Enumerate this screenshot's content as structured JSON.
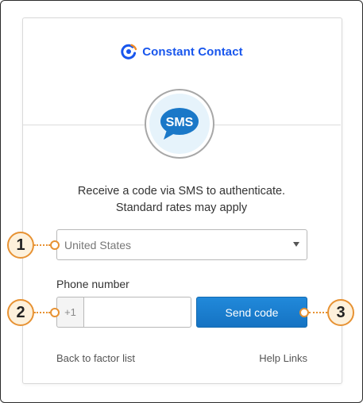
{
  "brand": {
    "name": "Constant Contact",
    "color": "#1856ed",
    "accent": "#f08a24",
    "icon": "constant-contact-logo-icon"
  },
  "sms_badge": {
    "text": "SMS",
    "icon": "sms-speech-bubble-icon",
    "color": "#1a78c8"
  },
  "message": {
    "line1": "Receive a code via SMS to authenticate.",
    "line2": "Standard rates may apply"
  },
  "country_select": {
    "selected": "United States",
    "icon": "chevron-down-icon"
  },
  "phone": {
    "label": "Phone number",
    "prefix": "+1",
    "value": "",
    "placeholder": ""
  },
  "send_button": {
    "label": "Send code",
    "color": "#1a7fd0"
  },
  "footer": {
    "back_label": "Back to factor list",
    "help_label": "Help Links"
  },
  "callouts": {
    "one": "1",
    "two": "2",
    "three": "3",
    "color": "#e79233"
  }
}
